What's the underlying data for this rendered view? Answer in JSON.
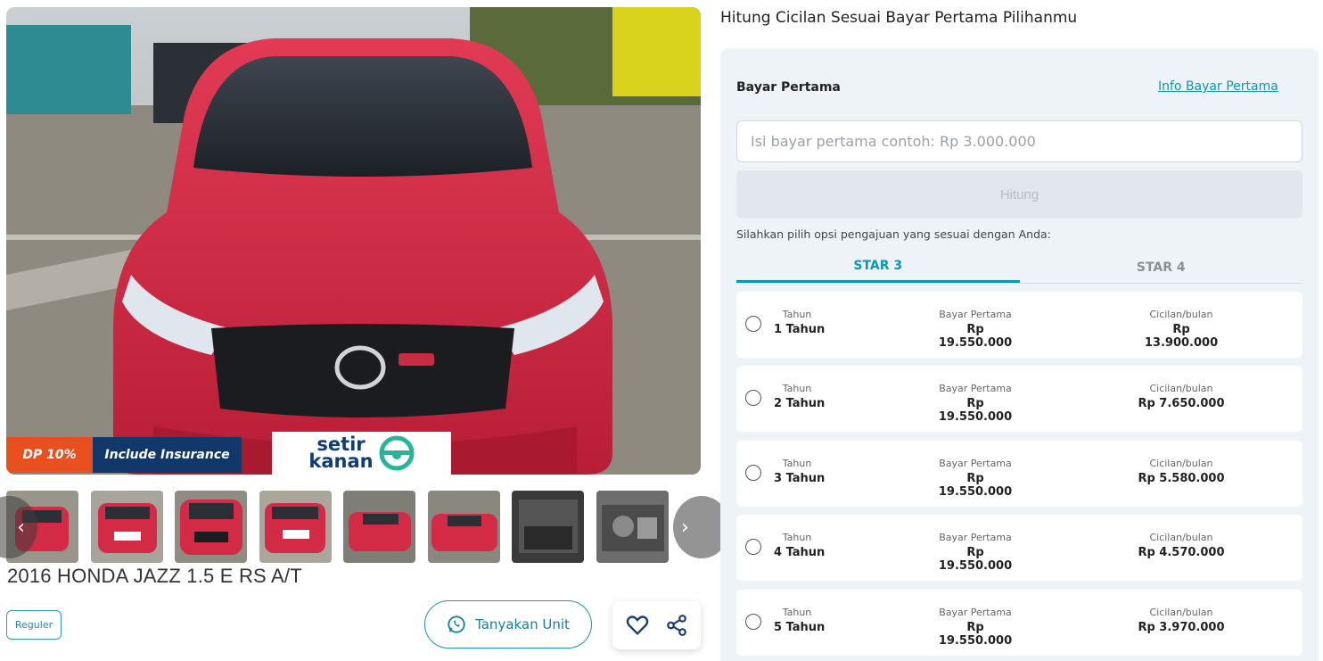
{
  "listing": {
    "title": "2016 HONDA JAZZ 1.5 E RS A/T",
    "badges": {
      "dp": "DP 10%",
      "insurance": "Include Insurance"
    },
    "brand_logo_line1": "setir",
    "brand_logo_line2": "kanan",
    "tag": "Reguler",
    "ask_button": "Tanyakan Unit",
    "icons": {
      "whatsapp": "whatsapp-icon",
      "favorite": "heart-icon",
      "share": "share-icon",
      "prev": "chevron-left-icon",
      "next": "chevron-right-icon"
    },
    "colors": {
      "dp_badge": "#e8501f",
      "insurance_badge": "#12386b",
      "accent": "#0b98b5"
    }
  },
  "calculator": {
    "heading": "Hitung Cicilan Sesuai Bayar Pertama Pilihanmu",
    "label": "Bayar Pertama",
    "info_link": "Info Bayar Pertama",
    "input_placeholder": "Isi bayar pertama contoh: Rp 3.000.000",
    "submit": "Hitung",
    "hint": "Silahkan pilih opsi pengajuan yang sesuai dengan Anda:",
    "tabs": [
      {
        "label": "STAR 3",
        "active": true
      },
      {
        "label": "STAR 4",
        "active": false
      }
    ],
    "col_labels": {
      "tenor": "Tahun",
      "dp": "Bayar Pertama",
      "installment": "Cicilan/bulan"
    },
    "plans": [
      {
        "tenor": "1 Tahun",
        "dp": "Rp 19.550.000",
        "installment": "Rp 13.900.000"
      },
      {
        "tenor": "2 Tahun",
        "dp": "Rp 19.550.000",
        "installment": "Rp 7.650.000"
      },
      {
        "tenor": "3 Tahun",
        "dp": "Rp 19.550.000",
        "installment": "Rp 5.580.000"
      },
      {
        "tenor": "4 Tahun",
        "dp": "Rp 19.550.000",
        "installment": "Rp 4.570.000"
      },
      {
        "tenor": "5 Tahun",
        "dp": "Rp 19.550.000",
        "installment": "Rp 3.970.000"
      }
    ]
  }
}
